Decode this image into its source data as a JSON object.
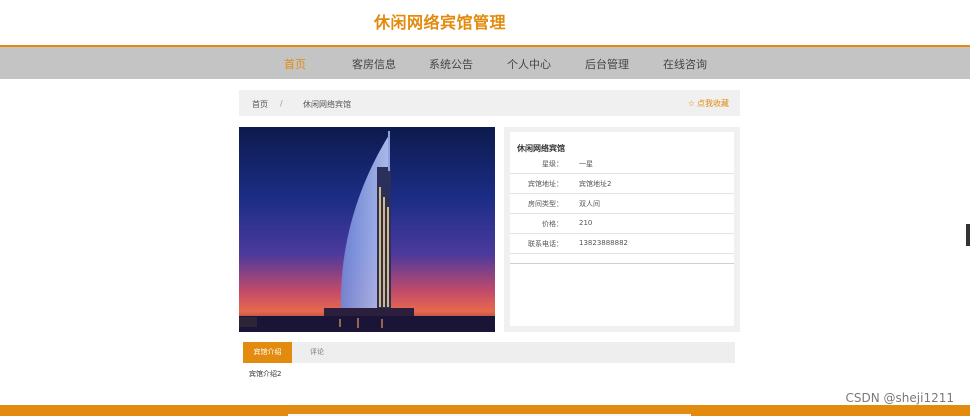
{
  "site": {
    "title": "休闲网络宾馆管理"
  },
  "nav": {
    "items": [
      {
        "label": "首页",
        "active": true
      },
      {
        "label": "客房信息",
        "active": false
      },
      {
        "label": "系统公告",
        "active": false
      },
      {
        "label": "个人中心",
        "active": false
      },
      {
        "label": "后台管理",
        "active": false
      },
      {
        "label": "在线咨询",
        "active": false
      }
    ]
  },
  "breadcrumb": {
    "home": "首页",
    "separator": "/",
    "current": "休闲网络宾馆",
    "favorite": "点我收藏",
    "favorite_icon": "star-outline-icon"
  },
  "photo": {
    "subject": "hotel-photo"
  },
  "hotel": {
    "name": "休闲网络宾馆",
    "details": [
      {
        "label": "星级：",
        "value": "一星"
      },
      {
        "label": "宾馆地址：",
        "value": "宾馆地址2"
      },
      {
        "label": "房间类型：",
        "value": "双人间"
      },
      {
        "label": "价格：",
        "value": "210"
      },
      {
        "label": "联系电话：",
        "value": "13823888882"
      }
    ]
  },
  "tabs": {
    "items": [
      {
        "label": "宾馆介绍",
        "active": true
      },
      {
        "label": "评论",
        "active": false
      }
    ],
    "content": "宾馆介绍2"
  },
  "watermark": "CSDN @sheji1211",
  "colors": {
    "accent": "#e28b0e",
    "nav_bg": "#c4c4c4",
    "panel_bg": "#f0f0f0"
  }
}
